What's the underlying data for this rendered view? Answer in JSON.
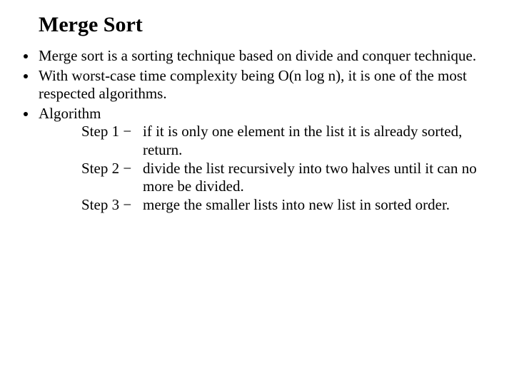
{
  "title": "Merge Sort",
  "bullets": {
    "b1": "Merge sort is a sorting technique based on divide and conquer technique.",
    "b2": "With worst-case time complexity being Ο(n log n), it is one of the most respected algorithms.",
    "b3": "Algorithm"
  },
  "steps": {
    "s1_label": "Step 1 −",
    "s1_body": "if it is only one element in the list it is already sorted, return.",
    "s2_label": "Step 2 −",
    "s2_body": "divide the list recursively into two halves until it can no more be divided.",
    "s3_label": "Step 3 −",
    "s3_body": "merge the smaller lists into new list in sorted order."
  }
}
